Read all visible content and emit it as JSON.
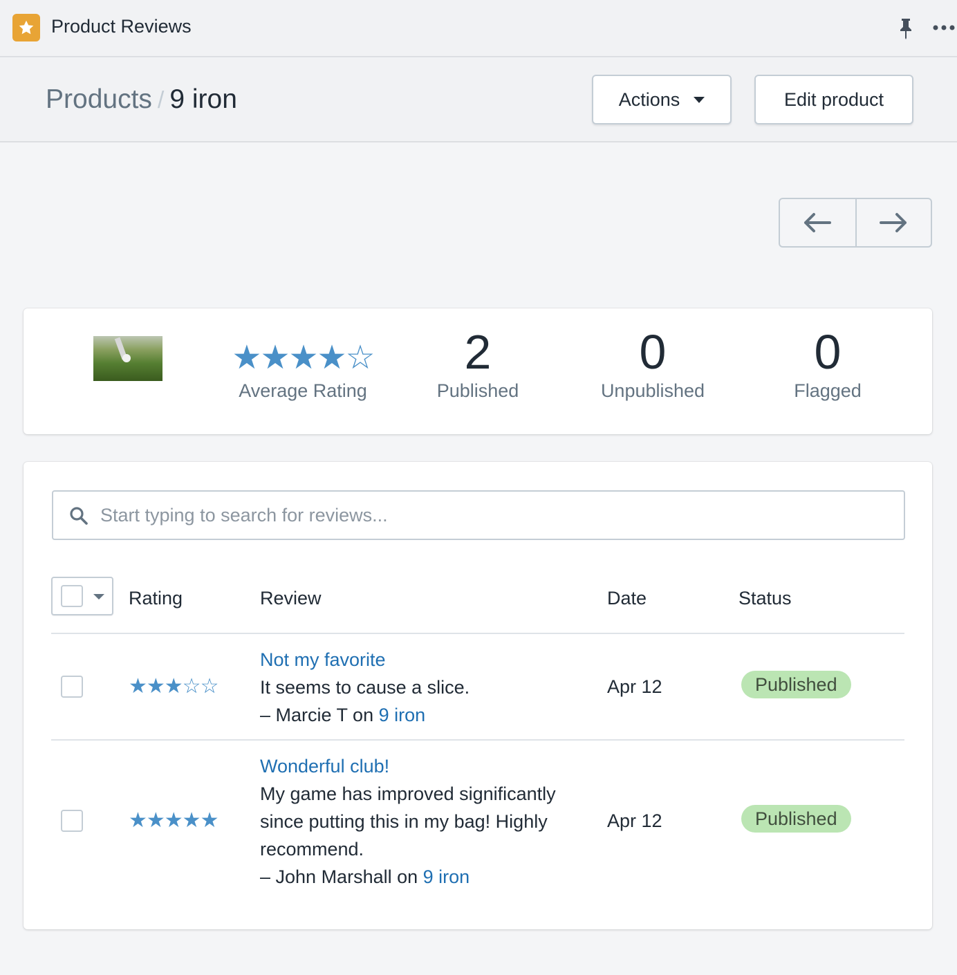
{
  "app": {
    "title": "Product Reviews",
    "icon": "star-icon",
    "accent": "#e8a435"
  },
  "breadcrumb": {
    "parent": "Products",
    "separator": "/",
    "current": "9 iron"
  },
  "header": {
    "actions_label": "Actions",
    "edit_label": "Edit product"
  },
  "pagination": {
    "prev_icon": "arrow-left-icon",
    "next_icon": "arrow-right-icon"
  },
  "summary": {
    "average_rating": 4,
    "average_rating_max": 5,
    "average_stars": "★★★★☆",
    "average_label": "Average Rating",
    "published_count": "2",
    "published_label": "Published",
    "unpublished_count": "0",
    "unpublished_label": "Unpublished",
    "flagged_count": "0",
    "flagged_label": "Flagged"
  },
  "search": {
    "placeholder": "Start typing to search for reviews...",
    "value": ""
  },
  "table": {
    "headers": {
      "rating": "Rating",
      "review": "Review",
      "date": "Date",
      "status": "Status"
    },
    "rows": [
      {
        "rating": 3,
        "stars": "★★★☆☆",
        "title": "Not my favorite",
        "body": "It seems to cause a slice.",
        "author_prefix": "– Marcie T on ",
        "product": "9 iron",
        "date": "Apr 12",
        "status": "Published",
        "checked": false
      },
      {
        "rating": 5,
        "stars": "★★★★★",
        "title": "Wonderful club!",
        "body": "My game has improved significantly since putting this in my bag! Highly recommend.",
        "author_prefix": "– John Marshall on ",
        "product": "9 iron",
        "date": "Apr 12",
        "status": "Published",
        "checked": false
      }
    ]
  },
  "colors": {
    "star": "#4a90c8",
    "link": "#1f6fb2",
    "badge_published": "#bbe5b3"
  }
}
